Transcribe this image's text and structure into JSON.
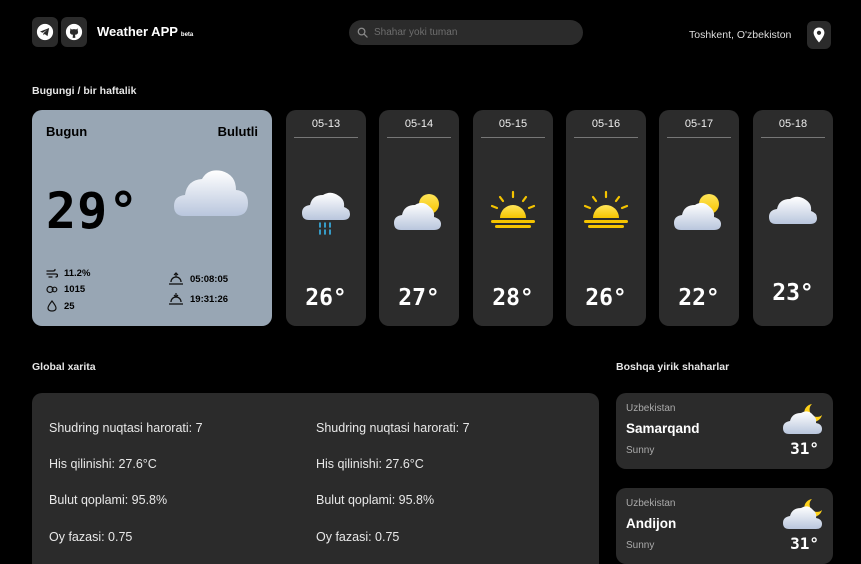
{
  "header": {
    "app_title": "Weather APP",
    "beta_badge": "beta",
    "search_placeholder": "Shahar yoki tuman",
    "location": "Toshkent, O'zbekiston"
  },
  "sections": {
    "weekly": "Bugungi / bir haftalik",
    "global_map": "Global xarita",
    "other_cities": "Boshqa yirik shaharlar"
  },
  "today": {
    "day_label": "Bugun",
    "condition": "Bulutli",
    "temperature": "29°",
    "wind": "11.2%",
    "pressure": "1015",
    "humidity": "25",
    "sunrise": "05:08:05",
    "sunset": "19:31:26"
  },
  "forecast": [
    {
      "date": "05-13",
      "temp": "26°",
      "icon": "rain-cloud-icon"
    },
    {
      "date": "05-14",
      "temp": "27°",
      "icon": "partly-cloudy-icon"
    },
    {
      "date": "05-15",
      "temp": "28°",
      "icon": "sunrise-sun-icon"
    },
    {
      "date": "05-16",
      "temp": "26°",
      "icon": "sunrise-sun-icon"
    },
    {
      "date": "05-17",
      "temp": "22°",
      "icon": "partly-cloudy-icon"
    },
    {
      "date": "05-18",
      "temp": "23°",
      "icon": "cloud-icon"
    }
  ],
  "global_stats": {
    "left": [
      "Shudring nuqtasi harorati: 7",
      "His qilinishi: 27.6°C",
      "Bulut qoplami: 95.8%",
      "Oy fazasi: 0.75"
    ],
    "right": [
      "Shudring nuqtasi harorati: 7",
      "His qilinishi: 27.6°C",
      "Bulut qoplami: 95.8%",
      "Oy fazasi: 0.75"
    ]
  },
  "cities": [
    {
      "country": "Uzbekistan",
      "name": "Samarqand",
      "condition": "Sunny",
      "temp": "31°",
      "icon": "cloud-moon-icon"
    },
    {
      "country": "Uzbekistan",
      "name": "Andijon",
      "condition": "Sunny",
      "temp": "31°",
      "icon": "cloud-moon-icon"
    }
  ],
  "colors": {
    "background": "#000000",
    "card": "#2c2c2c",
    "today_card": "#98a6b4",
    "sun": "#ffd21a"
  }
}
